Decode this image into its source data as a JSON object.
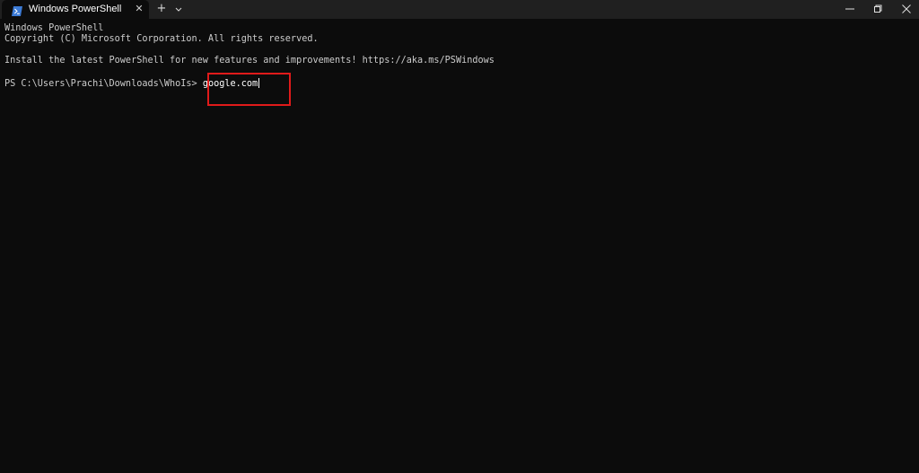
{
  "window": {
    "tab_title": "Windows PowerShell",
    "tab_icon": "powershell-icon",
    "close_tab_icon": "close-icon",
    "new_tab_label": "+",
    "dropdown_icon": "chevron-down-icon",
    "controls": [
      "minimize-icon",
      "maximize-icon",
      "close-icon"
    ]
  },
  "terminal": {
    "lines": [
      "Windows PowerShell",
      "Copyright (C) Microsoft Corporation. All rights reserved.",
      "Install the latest PowerShell for new features and improvements! https://aka.ms/PSWindows"
    ],
    "prompt": "PS C:\\Users\\Prachi\\Downloads\\WhoIs> ",
    "command": "google.com"
  },
  "colors": {
    "background": "#0c0c0c",
    "titlebar": "#202020",
    "text": "#cccccc",
    "highlight": "#e01a1a"
  }
}
